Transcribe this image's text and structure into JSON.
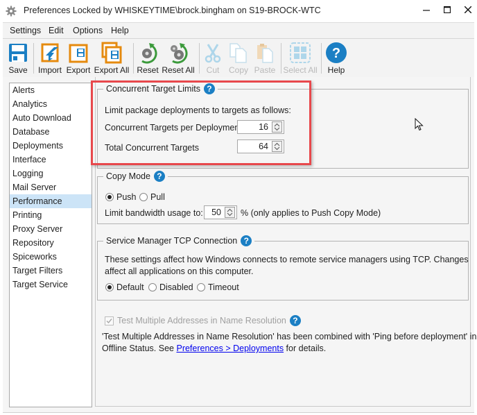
{
  "window": {
    "title": "Preferences Locked by WHISKEYTIME\\brock.bingham on S19-BROCK-WTC",
    "controls": [
      "minimize",
      "maximize",
      "close"
    ]
  },
  "menu": [
    "Settings",
    "Edit",
    "Options",
    "Help"
  ],
  "toolbar": {
    "save": "Save",
    "import": "Import",
    "export": "Export",
    "export_all": "Export All",
    "reset": "Reset",
    "reset_all": "Reset All",
    "cut": "Cut",
    "copy": "Copy",
    "paste": "Paste",
    "select_all": "Select All",
    "help": "Help"
  },
  "sidebar": {
    "items": [
      "Alerts",
      "Analytics",
      "Auto Download",
      "Database",
      "Deployments",
      "Interface",
      "Logging",
      "Mail Server",
      "Performance",
      "Printing",
      "Proxy Server",
      "Repository",
      "Spiceworks",
      "Target Filters",
      "Target Service"
    ],
    "selected": "Performance"
  },
  "concurrent": {
    "legend": "Concurrent Target Limits",
    "description": "Limit package deployments to targets as follows:",
    "per_deployment_label": "Concurrent Targets per Deployment",
    "per_deployment_value": "16",
    "total_label": "Total Concurrent Targets",
    "total_value": "64"
  },
  "copy_mode": {
    "legend": "Copy Mode",
    "push": "Push",
    "pull": "Pull",
    "selected": "Push",
    "bandwidth_label": "Limit bandwidth usage to:",
    "bandwidth_value": "50",
    "bandwidth_suffix": "% (only applies to Push Copy Mode)"
  },
  "tcp": {
    "legend": "Service Manager TCP Connection",
    "description_line1": "These settings affect how Windows connects to remote service managers using TCP. Changes",
    "description_line2": "affect all applications on this computer.",
    "default": "Default",
    "disabled": "Disabled",
    "timeout": "Timeout",
    "selected": "Default"
  },
  "name_resolution": {
    "checkbox_label": "Test Multiple Addresses in Name Resolution",
    "checked": true,
    "enabled": false,
    "note_line1": "'Test Multiple Addresses in Name Resolution' has been combined with 'Ping before deployment' in",
    "note_line2_prefix": "Offline Status. See ",
    "note_link": "Preferences > Deployments",
    "note_line2_suffix": " for details."
  },
  "colors": {
    "accent_blue": "#1b7fc4",
    "selection": "#cce4f7",
    "highlight_border": "#e8484c",
    "toolbar_orange": "#e58a0e",
    "reset_green": "#3c9a3c"
  }
}
